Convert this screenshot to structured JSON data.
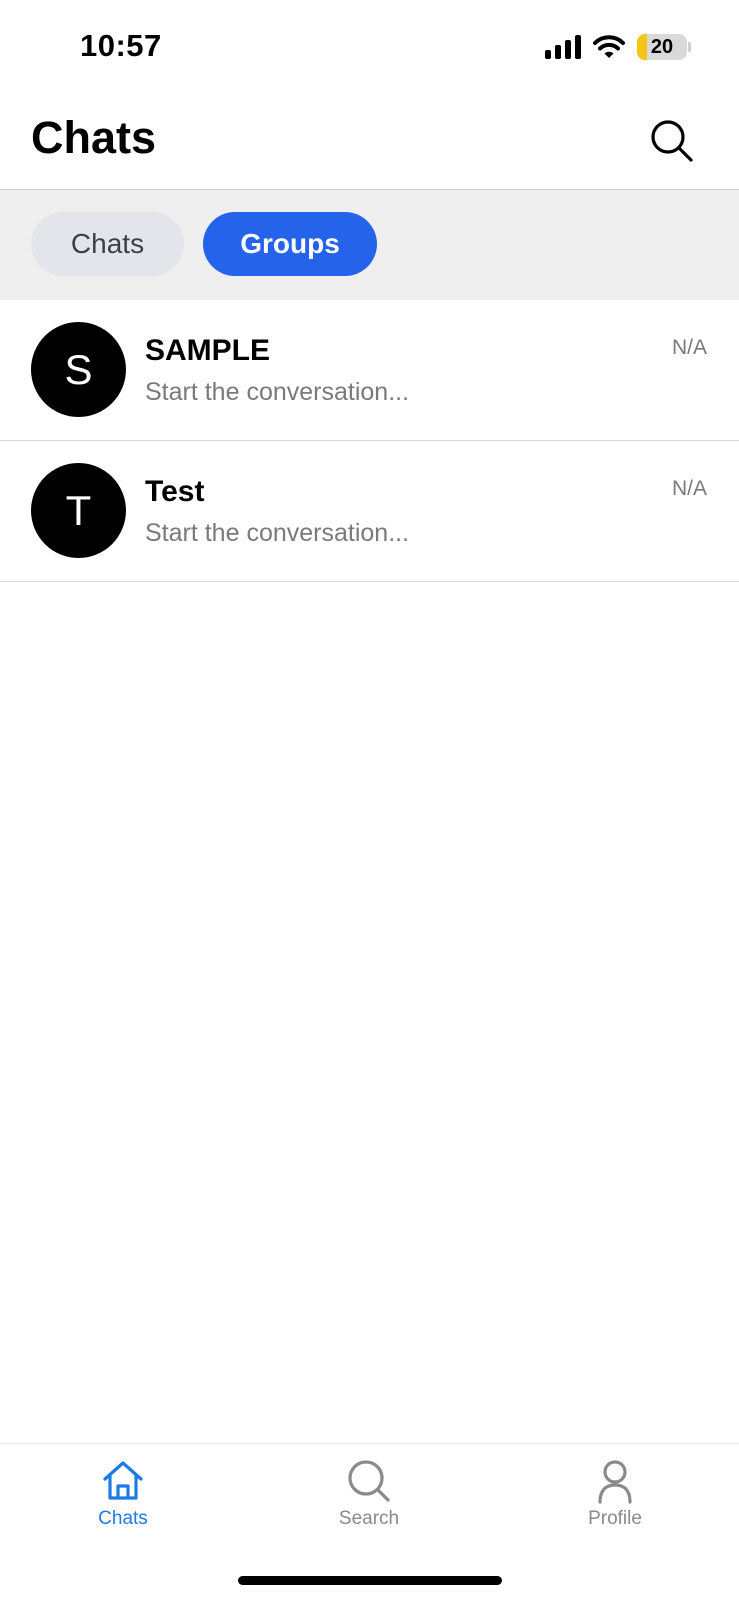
{
  "status_bar": {
    "time": "10:57",
    "battery_level": "20",
    "battery_fraction": 0.2,
    "battery_color": "#f5c518"
  },
  "header": {
    "title": "Chats",
    "search_icon": "search-icon"
  },
  "segments": [
    {
      "label": "Chats",
      "selected": false
    },
    {
      "label": "Groups",
      "selected": true
    }
  ],
  "accent_color": "#2563eb",
  "conversations": [
    {
      "initial": "S",
      "name": "SAMPLE",
      "preview": "Start the conversation...",
      "time": "N/A"
    },
    {
      "initial": "T",
      "name": "Test",
      "preview": "Start the conversation...",
      "time": "N/A"
    }
  ],
  "tabbar": {
    "tabs": [
      {
        "label": "Chats",
        "icon": "home-icon",
        "active": true
      },
      {
        "label": "Search",
        "icon": "search-icon",
        "active": false
      },
      {
        "label": "Profile",
        "icon": "person-icon",
        "active": false
      }
    ],
    "active_color": "#1e7be6"
  }
}
